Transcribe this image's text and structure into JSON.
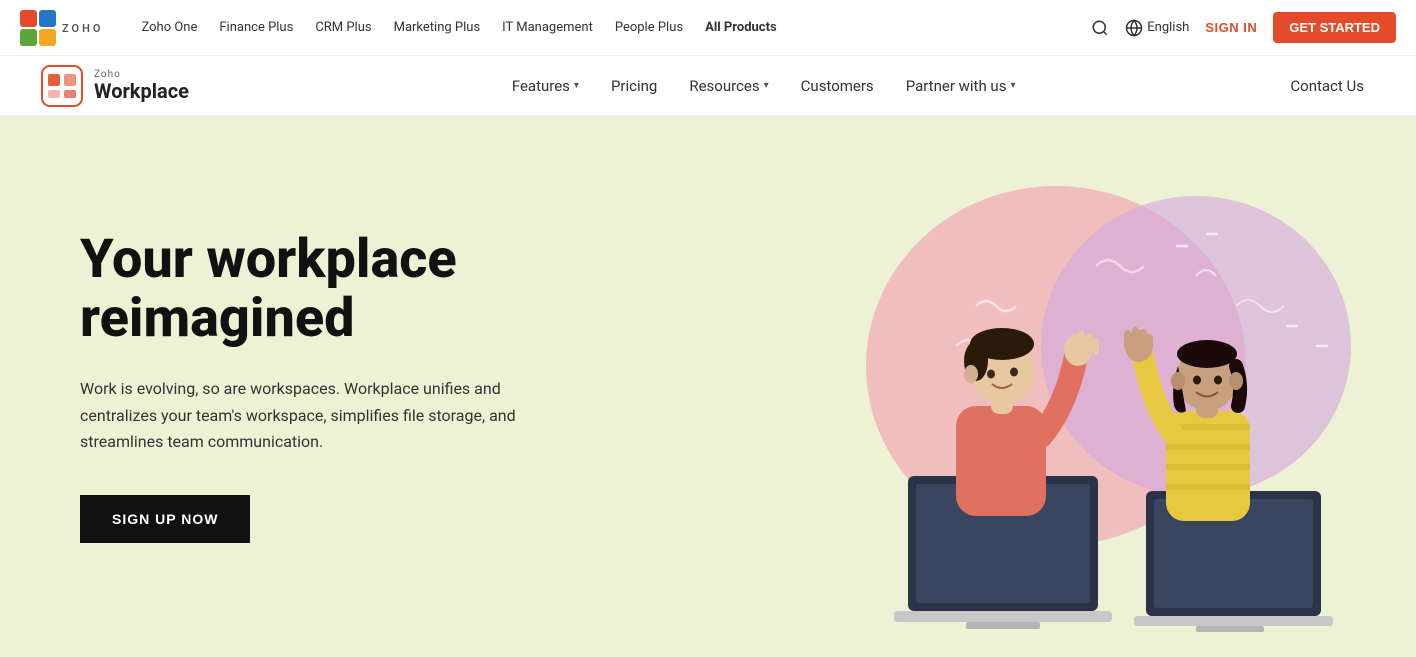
{
  "topNav": {
    "links": [
      {
        "label": "Zoho One",
        "active": false
      },
      {
        "label": "Finance Plus",
        "active": false
      },
      {
        "label": "CRM Plus",
        "active": false
      },
      {
        "label": "Marketing Plus",
        "active": false
      },
      {
        "label": "IT Management",
        "active": false
      },
      {
        "label": "People Plus",
        "active": false
      },
      {
        "label": "All Products",
        "active": true
      }
    ],
    "language": "English",
    "signIn": "SIGN IN",
    "getStarted": "GET STARTED"
  },
  "secondaryNav": {
    "brandLabel": "Zoho",
    "productName": "Workplace",
    "links": [
      {
        "label": "Features",
        "hasDropdown": true
      },
      {
        "label": "Pricing",
        "hasDropdown": false
      },
      {
        "label": "Resources",
        "hasDropdown": true
      },
      {
        "label": "Customers",
        "hasDropdown": false
      },
      {
        "label": "Partner with us",
        "hasDropdown": true
      }
    ],
    "contactUs": "Contact Us"
  },
  "hero": {
    "title": "Your workplace reimagined",
    "subtitle": "Work is evolving, so are workspaces. Workplace unifies and centralizes your team's workspace, simplifies file storage, and streamlines team communication.",
    "cta": "SIGN UP NOW"
  },
  "colors": {
    "accent": "#e34b2b",
    "heroBg": "#eef2d4",
    "dark": "#111111",
    "blobPink": "#f4a0b5",
    "blobPurple": "#d4aadd"
  }
}
